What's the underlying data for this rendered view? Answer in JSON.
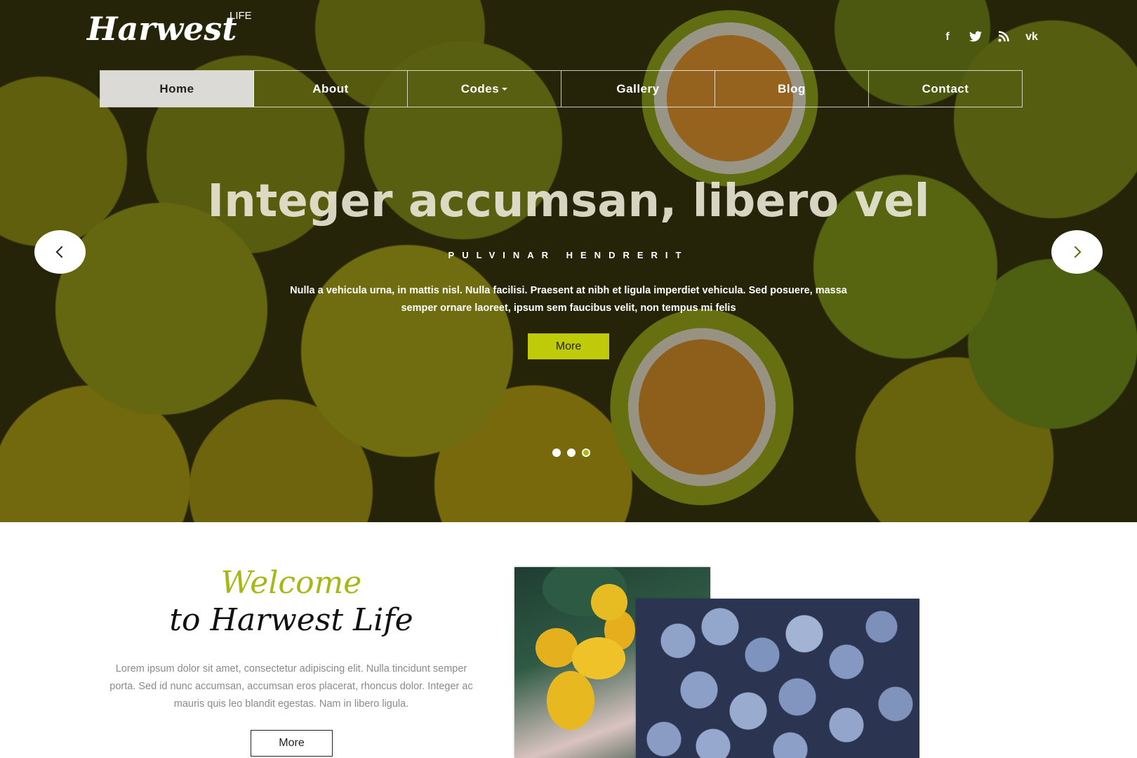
{
  "header": {
    "logo": "Harwest",
    "logo_sub": "LIFE",
    "social": [
      {
        "name": "facebook-icon",
        "glyph": "f"
      },
      {
        "name": "twitter-icon",
        "glyph": "🐦"
      },
      {
        "name": "rss-icon",
        "glyph": "))"
      },
      {
        "name": "vk-icon",
        "glyph": "vk"
      }
    ]
  },
  "nav": {
    "items": [
      {
        "label": "Home",
        "active": true
      },
      {
        "label": "About"
      },
      {
        "label": "Codes",
        "dropdown": true
      },
      {
        "label": "Gallery"
      },
      {
        "label": "Blog"
      },
      {
        "label": "Contact"
      }
    ]
  },
  "hero": {
    "title": "Integer accumsan, libero vel",
    "subtitle": "PULVINAR HENDRERIT",
    "text": "Nulla a vehicula urna, in mattis nisl. Nulla facilisi. Praesent at nibh et ligula imperdiet vehicula. Sed posuere, massa semper ornare laoreet, ipsum sem faucibus velit, non tempus mi felis",
    "button": "More",
    "slides": 3,
    "active_slide": 3,
    "accent_color": "#bfcb08"
  },
  "welcome": {
    "line1": "Welcome",
    "line2": "to Harwest Life",
    "text": "Lorem ipsum dolor sit amet, consectetur adipiscing elit. Nulla tincidunt semper porta. Sed id nunc accumsan, accumsan eros placerat, rhoncus dolor. Integer ac mauris quis leo blandit egestas. Nam in libero ligula.",
    "button": "More",
    "accent_color": "#a7b814"
  }
}
